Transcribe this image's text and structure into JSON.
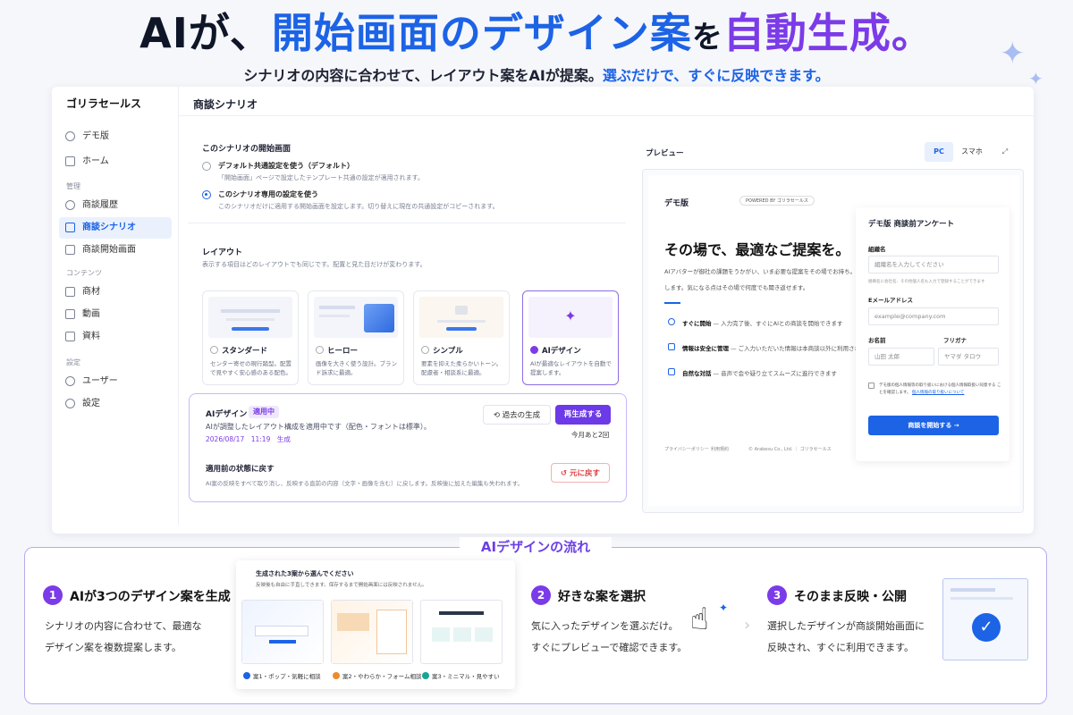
{
  "hero": {
    "title_part1": "AIが、",
    "title_part2": "開始画面のデザイン案",
    "title_part3": "を",
    "title_part4": "自動生成",
    "title_part5": "。",
    "subtitle_part1": "シナリオの内容に合わせて、レイアウト案をAIが提案。",
    "subtitle_part2": "選ぶだけで、すぐに反映できます。"
  },
  "sidebar": {
    "logo": "ゴリラセールス",
    "items": [
      {
        "label": "デモ版",
        "icon": "globe-icon"
      },
      {
        "label": "ホーム",
        "icon": "grid-icon"
      }
    ],
    "section_manage": "管理",
    "manage_items": [
      {
        "label": "商談履歴",
        "icon": "history-icon"
      },
      {
        "label": "商談シナリオ",
        "icon": "book-icon",
        "active": true
      },
      {
        "label": "商談開始画面",
        "icon": "screen-icon"
      }
    ],
    "section_contents": "コンテンツ",
    "content_items": [
      {
        "label": "商材",
        "icon": "box-icon"
      },
      {
        "label": "動画",
        "icon": "video-icon"
      },
      {
        "label": "資料",
        "icon": "document-icon"
      }
    ],
    "section_settings": "設定",
    "settings_items": [
      {
        "label": "ユーザー",
        "icon": "users-icon"
      },
      {
        "label": "設定",
        "icon": "gear-icon"
      }
    ]
  },
  "main": {
    "title": "商談シナリオ",
    "start_screen": {
      "heading": "このシナリオの開始画面",
      "option1_label": "デフォルト共通設定を使う（デフォルト）",
      "option1_desc": "「開始画面」ページで設定したテンプレート共通の設定が適用されます。",
      "option2_label": "このシナリオ専用の設定を使う",
      "option2_desc": "このシナリオだけに適用する開始画面を設定します。切り替えに現在の共通設定がコピーされます。"
    },
    "layout": {
      "heading": "レイアウト",
      "desc": "表示する項目はどのレイアウトでも同じです。配置と見た目だけが変わります。",
      "cards": [
        {
          "label": "スタンダード",
          "desc": "センター寄せの現行踏型。配置で見やすく安心感のある配色。"
        },
        {
          "label": "ヒーロー",
          "desc": "画像を大きく使う設計。ブランド訴求に最適。"
        },
        {
          "label": "シンプル",
          "desc": "要素を抑えた柔らかいトーン。配慮者・相談系に最適。"
        },
        {
          "label": "AIデザイン",
          "desc": "AIが最適なレイアウトを自動で提案します。"
        }
      ]
    },
    "ai_panel": {
      "title": "AIデザイン",
      "badge": "適用中",
      "desc": "AIが調整したレイアウト構成を適用中です（配色・フォントは標準）。",
      "timestamp": "2026/08/17　11:19　生成",
      "history_button": "過去の生成",
      "regenerate_button": "再生成する",
      "remaining": "今月あと2回",
      "restore_heading": "適用前の状態に戻す",
      "restore_desc": "AI案の反映をすべて取り消し、反映する直前の内容（文字・画像を含む）に戻します。反映後に加えた編集も失われます。",
      "restore_button": "元に戻す"
    },
    "preview": {
      "label": "プレビュー",
      "toggle_pc": "PC",
      "toggle_mobile": "スマホ",
      "brand": "デモ版",
      "powered": "POWERED BY ゴリラセールス",
      "headline": "その場で、最適なご提案を。",
      "lead1": "AIアバターが御社の課題をうかがい、いま必要な提案をその場でお持ち。",
      "lead2": "します。気になる点はその場で何度でも聞き返せます。",
      "features": [
        {
          "title": "すぐに開始",
          "desc": "— 入力完了後、すぐにAIとの商談を開始できます"
        },
        {
          "title": "情報は安全に管理",
          "desc": "— ご入力いただいた情報は本商談以外に利用されません"
        },
        {
          "title": "自然な対話",
          "desc": "— 音声で会や疑り立てスムーズに進行できます"
        }
      ],
      "footer_links": [
        "プライバシーポリシー",
        "利用規約",
        "© Arabesu Co., Ltd. ｜ ゴリラセールス"
      ],
      "form": {
        "title": "デモ版 商談前アンケート",
        "org_label": "組織名",
        "org_placeholder": "組織名を入力してください",
        "org_hint": "組織名に会社名、その他個人名も入力で登録することができます",
        "email_label": "Eメールアドレス",
        "email_placeholder": "example@company.com",
        "name_label": "お名前",
        "kana_label": "フリガナ",
        "name_placeholder": "山田 太郎",
        "kana_placeholder": "ヤマダ タロウ",
        "consent": "デモ版の個人情報等の取り扱いにおける個人情報取扱い同意する",
        "consent2": "ことを確認します。",
        "consent_link": "個人情報の取り扱いについて",
        "submit": "商談を開始する →"
      }
    }
  },
  "flow": {
    "title": "AIデザインの流れ",
    "steps": [
      {
        "num": "1",
        "title": "AIが3つのデザイン案を生成",
        "desc1": "シナリオの内容に合わせて、最適な",
        "desc2": "デザイン案を複数提案します。"
      },
      {
        "num": "2",
        "title": "好きな案を選択",
        "desc1": "気に入ったデザインを選ぶだけ。",
        "desc2": "すぐにプレビューで確認できます。"
      },
      {
        "num": "3",
        "title": "そのまま反映・公開",
        "desc1": "選択したデザインが商談開始画面に",
        "desc2": "反映され、すぐに利用できます。"
      }
    ],
    "proposals": {
      "title": "生成された3案から選んでください",
      "subtitle": "反映後も自由に手直しできます。保存するまで開始画面には反映されません。",
      "options": [
        {
          "label": "案1・ポップ・気軽に相談",
          "color": "#1c63e6"
        },
        {
          "label": "案2・やわらか・フォーム相談",
          "color": "#f08a2b"
        },
        {
          "label": "案3・ミニマル・見やすい",
          "color": "#17a596"
        }
      ]
    }
  }
}
